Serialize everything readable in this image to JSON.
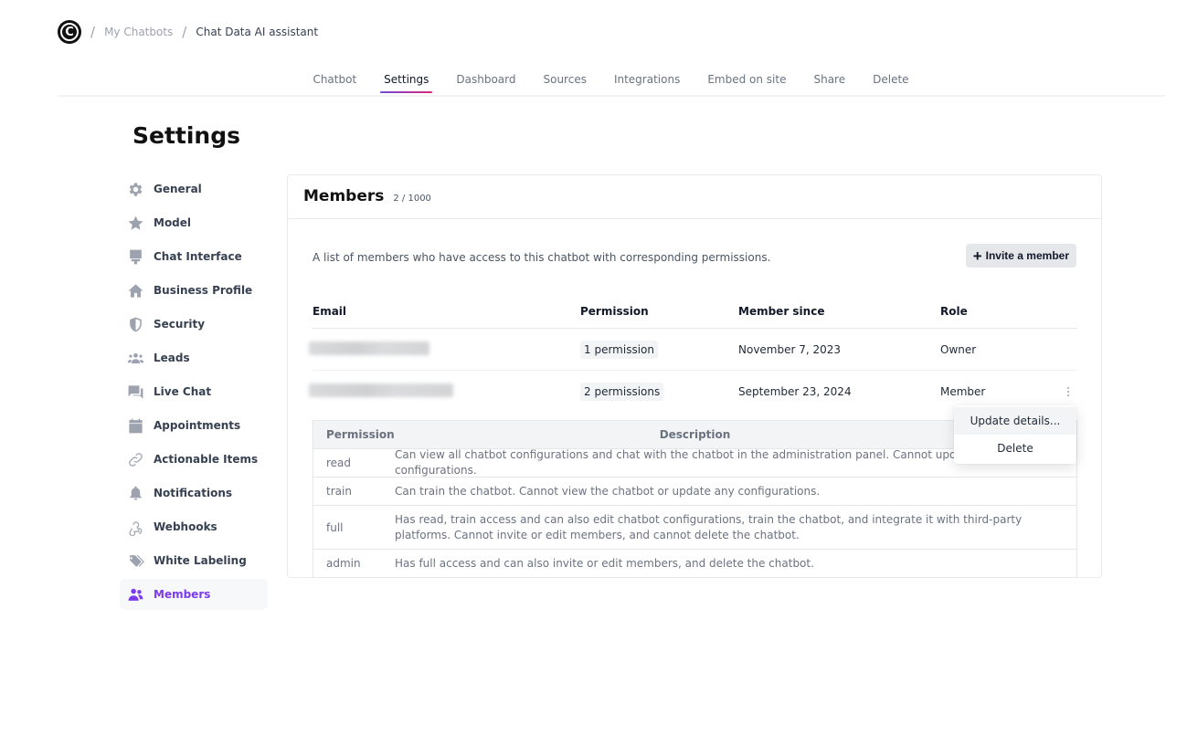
{
  "breadcrumb": {
    "logo_letter": "C",
    "items": [
      "My Chatbots",
      "Chat Data AI assistant"
    ]
  },
  "tabs": [
    {
      "label": "Chatbot",
      "active": false
    },
    {
      "label": "Settings",
      "active": true
    },
    {
      "label": "Dashboard",
      "active": false
    },
    {
      "label": "Sources",
      "active": false
    },
    {
      "label": "Integrations",
      "active": false
    },
    {
      "label": "Embed on site",
      "active": false
    },
    {
      "label": "Share",
      "active": false
    },
    {
      "label": "Delete",
      "active": false
    }
  ],
  "page_title": "Settings",
  "sidebar": {
    "items": [
      {
        "label": "General",
        "icon": "gear-icon"
      },
      {
        "label": "Model",
        "icon": "star-icon"
      },
      {
        "label": "Chat Interface",
        "icon": "chat-interface-icon"
      },
      {
        "label": "Business Profile",
        "icon": "home-icon"
      },
      {
        "label": "Security",
        "icon": "shield-icon"
      },
      {
        "label": "Leads",
        "icon": "users-group-icon"
      },
      {
        "label": "Live Chat",
        "icon": "chat-bubbles-icon"
      },
      {
        "label": "Appointments",
        "icon": "calendar-icon"
      },
      {
        "label": "Actionable Items",
        "icon": "link-icon"
      },
      {
        "label": "Notifications",
        "icon": "bell-icon"
      },
      {
        "label": "Webhooks",
        "icon": "webhook-icon"
      },
      {
        "label": "White Labeling",
        "icon": "tags-icon"
      },
      {
        "label": "Members",
        "icon": "members-icon",
        "active": true
      }
    ]
  },
  "members": {
    "title": "Members",
    "count": "2 / 1000",
    "description": "A list of members who have access to this chatbot with corresponding permissions.",
    "invite_label": "Invite a member",
    "columns": [
      "Email",
      "Permission",
      "Member since",
      "Role"
    ],
    "rows": [
      {
        "email": "",
        "email_redacted": true,
        "permission": "1 permission",
        "member_since": "November 7, 2023",
        "role": "Owner"
      },
      {
        "email": "",
        "email_redacted": true,
        "permission": "2 permissions",
        "member_since": "September 23, 2024",
        "role": "Member"
      }
    ]
  },
  "permissions_table": {
    "columns": [
      "Permission",
      "Description"
    ],
    "rows": [
      {
        "name": "read",
        "description": "Can view all chatbot configurations and chat with the chatbot in the administration panel. Cannot update any configurations."
      },
      {
        "name": "train",
        "description": "Can train the chatbot. Cannot view the chatbot or update any configurations."
      },
      {
        "name": "full",
        "description": "Has read, train access and can also edit chatbot configurations, train the chatbot, and integrate it with third-party platforms. Cannot invite or edit members, and cannot delete the chatbot."
      },
      {
        "name": "admin",
        "description": "Has full access and can also invite or edit members, and delete the chatbot."
      }
    ]
  },
  "row_menu": {
    "items": [
      "Update details...",
      "Delete"
    ]
  },
  "colors": {
    "accent": "#7c3aed",
    "tab_underline_start": "#6d4bd8",
    "tab_underline_end": "#e0267c"
  }
}
